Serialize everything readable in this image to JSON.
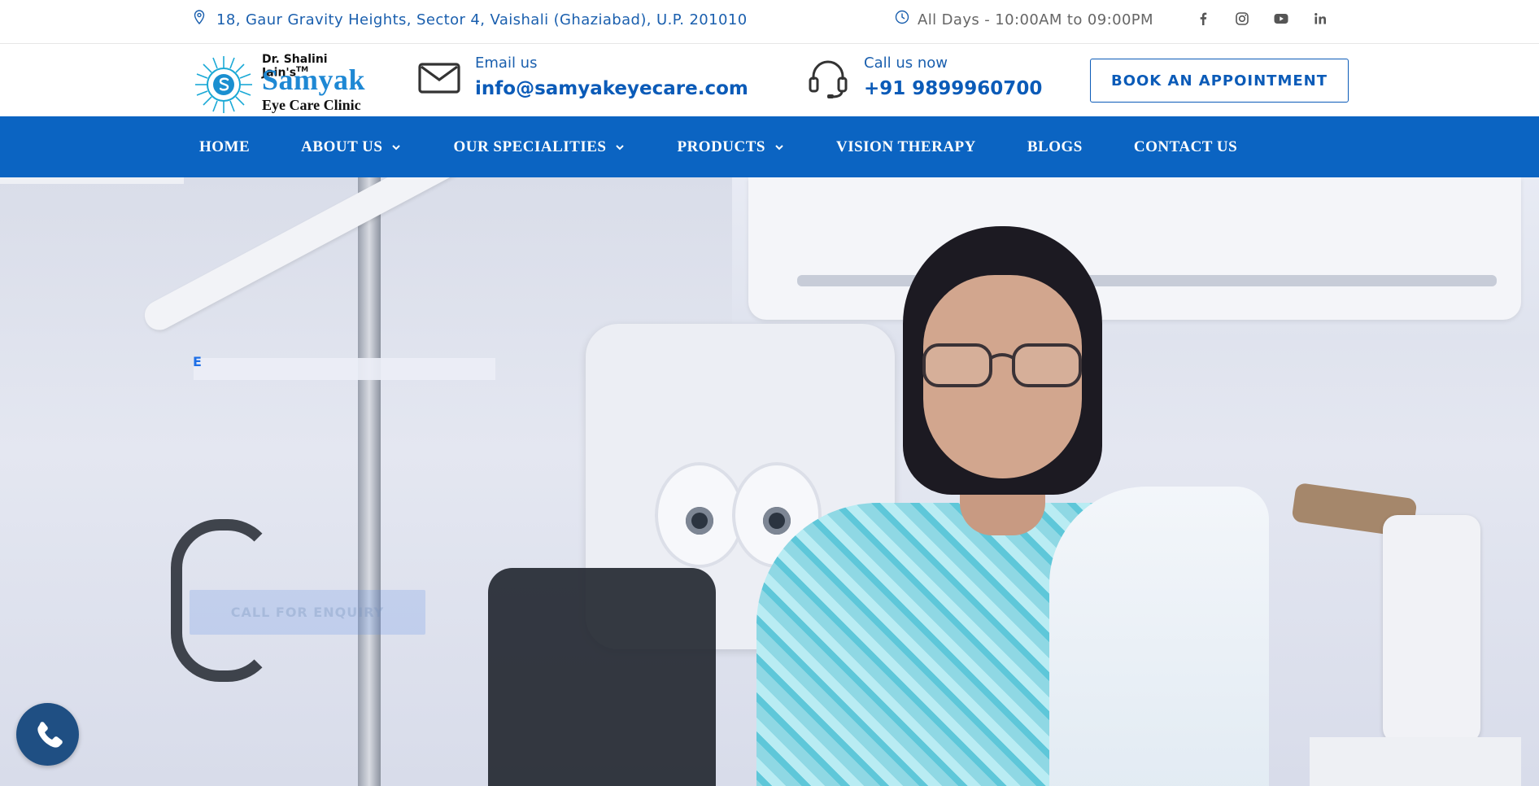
{
  "topbar": {
    "address": "18, Gaur Gravity Heights, Sector 4, Vaishali (Ghaziabad), U.P. 201010",
    "hours": "All Days - 10:00AM to 09:00PM",
    "social_icons": [
      "facebook-icon",
      "instagram-icon",
      "youtube-icon",
      "linkedin-icon"
    ]
  },
  "brand": {
    "doctor": "Dr. Shalini Jain's",
    "trademark": "TM",
    "name": "Samyak",
    "subtitle": "Eye Care Clinic"
  },
  "contacts": {
    "email_label": "Email us",
    "email_value": "info@samyakeyecare.com",
    "phone_label": "Call us now",
    "phone_value": "+91 9899960700"
  },
  "header": {
    "book_label": "BOOK AN APPOINTMENT"
  },
  "nav": {
    "items": [
      {
        "label": "HOME",
        "dropdown": false
      },
      {
        "label": "ABOUT US",
        "dropdown": true
      },
      {
        "label": "OUR SPECIALITIES",
        "dropdown": true
      },
      {
        "label": "PRODUCTS",
        "dropdown": true
      },
      {
        "label": "VISION THERAPY",
        "dropdown": false
      },
      {
        "label": "BLOGS",
        "dropdown": false
      },
      {
        "label": "CONTACT US",
        "dropdown": false
      }
    ]
  },
  "hero": {
    "kicker": "E",
    "enquiry_label": "CALL FOR ENQUIRY"
  },
  "colors": {
    "brand_blue": "#0b64c2",
    "link_blue": "#0b5bb8",
    "fab": "#1f4f83"
  }
}
